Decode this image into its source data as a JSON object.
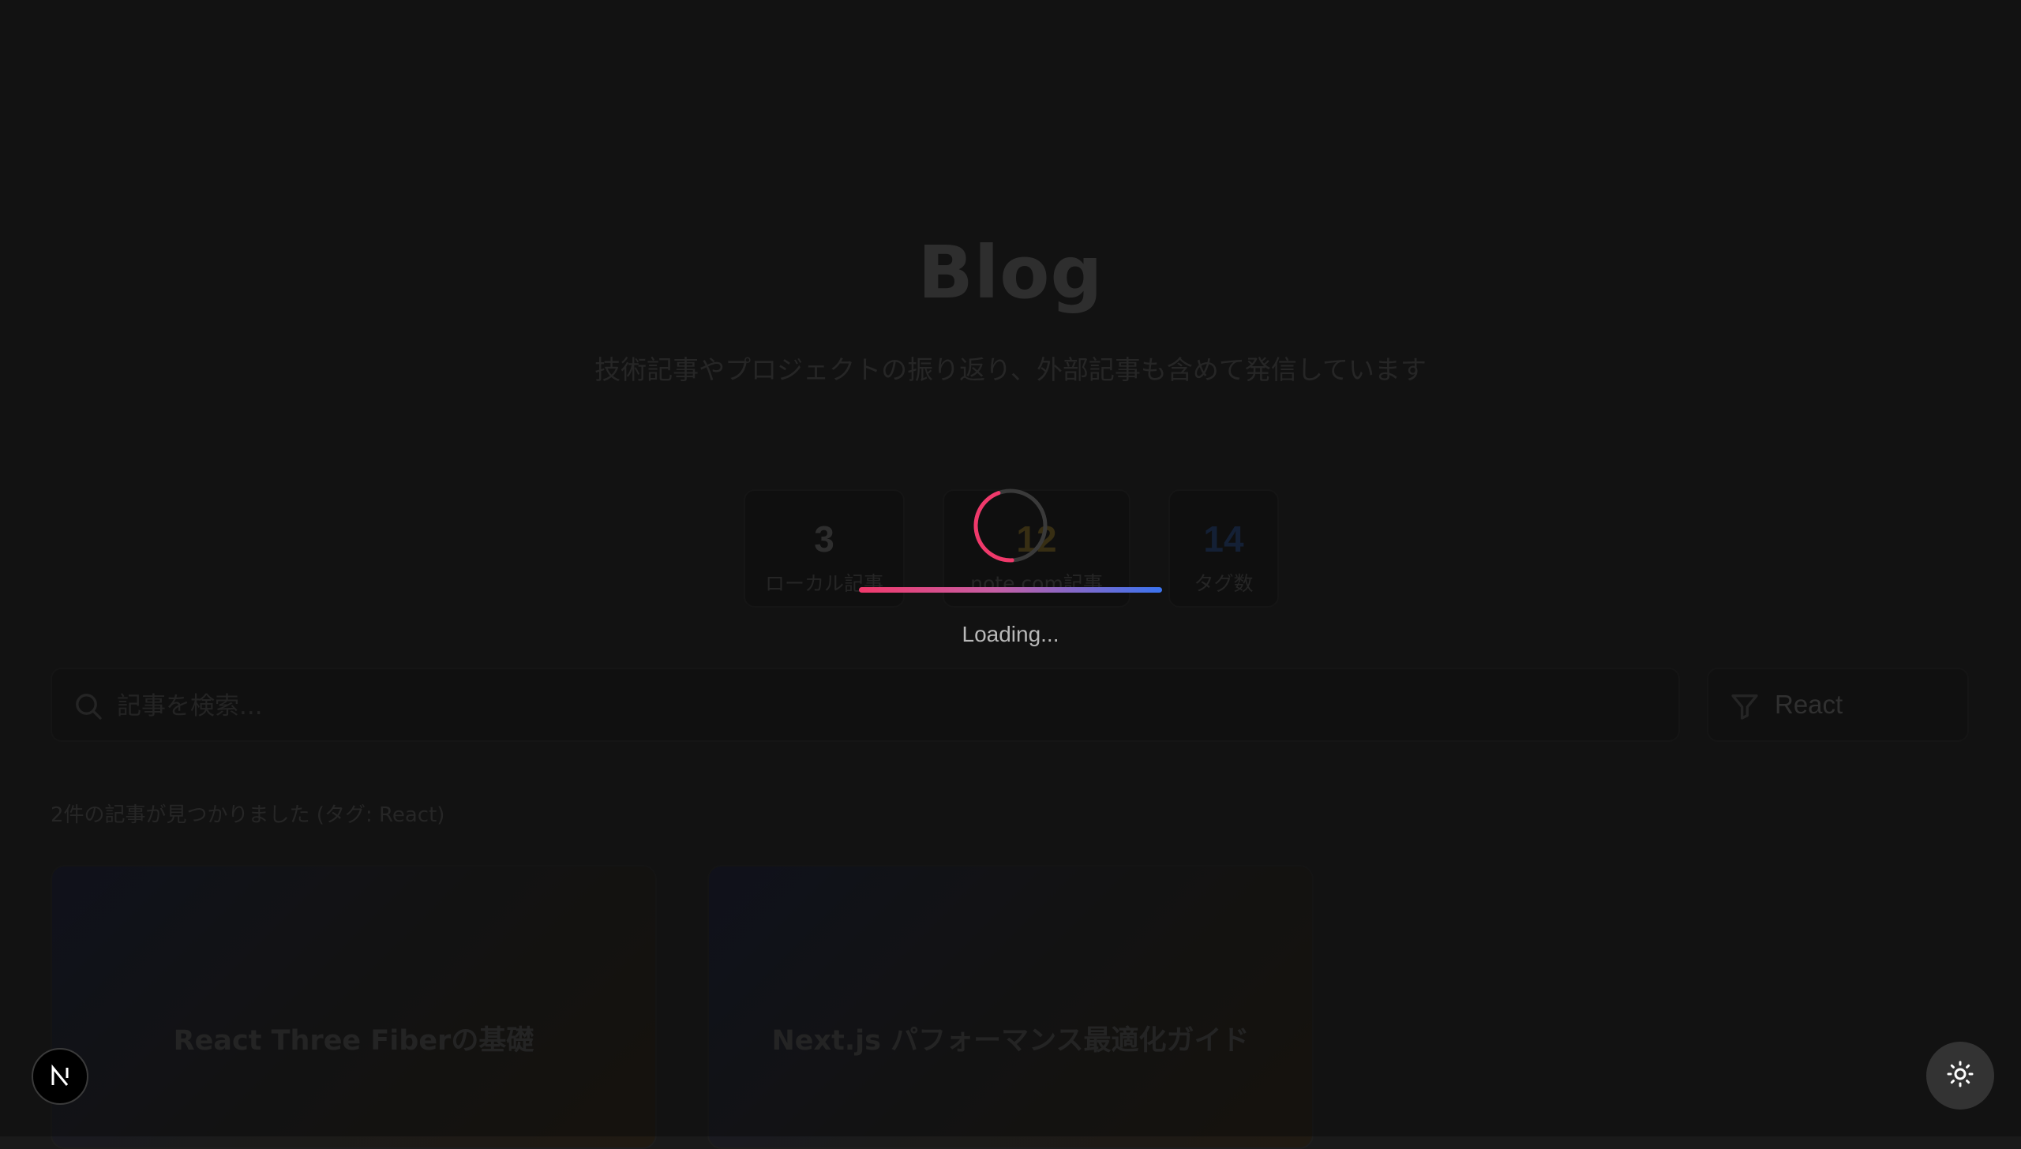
{
  "page": {
    "title": "Blog",
    "subtitle": "技術記事やプロジェクトの振り返り、外部記事も含めて発信しています"
  },
  "stats": [
    {
      "value": "3",
      "label": "ローカル記事"
    },
    {
      "value": "12",
      "label": "note.com記事"
    },
    {
      "value": "14",
      "label": "タグ数"
    }
  ],
  "search": {
    "placeholder": "記事を検索...",
    "icon": "search-icon"
  },
  "filter": {
    "selected": "React",
    "icon": "filter-icon"
  },
  "results": {
    "summary": "2件の記事が見つかりました (タグ: React)"
  },
  "articles": [
    {
      "title": "React Three Fiberの基礎"
    },
    {
      "title": "Next.js パフォーマンス最適化ガイド"
    }
  ],
  "loader": {
    "text": "Loading...",
    "colors": {
      "start": "#f0396b",
      "end": "#3b74f0"
    }
  },
  "floating": {
    "next_badge_icon": "nextjs-logo-icon",
    "theme_toggle_icon": "sun-icon"
  },
  "colors": {
    "background": "#1a1a1a",
    "stat_note": "#c79a2a",
    "stat_tags": "#3b6fd1"
  }
}
